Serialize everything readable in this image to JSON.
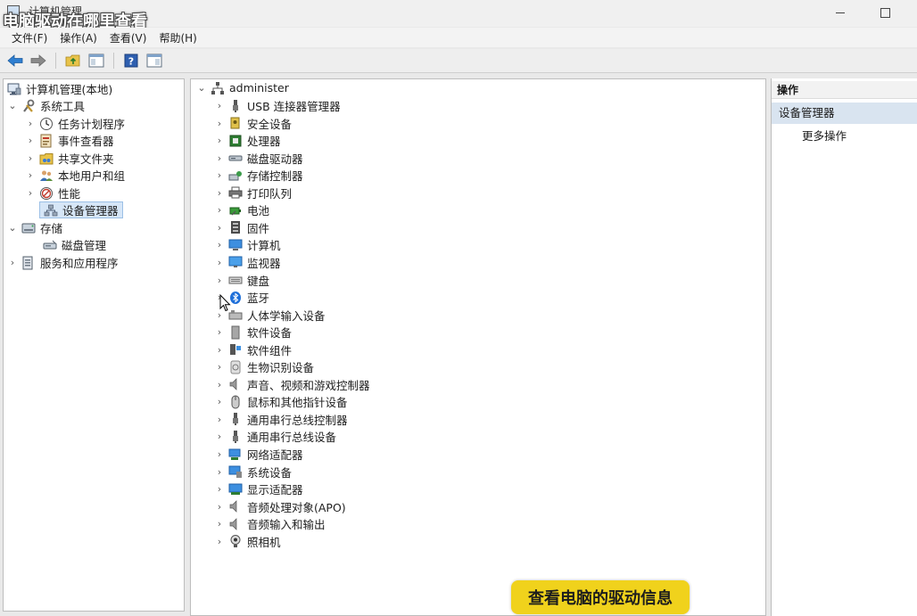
{
  "window": {
    "title": "计算机管理",
    "overlay_title": "电脑驱动在哪里查看"
  },
  "menu": [
    "文件(F)",
    "操作(A)",
    "查看(V)",
    "帮助(H)"
  ],
  "toolbar": {
    "icons": [
      "back-arrow-icon",
      "forward-arrow-icon",
      "up-folder-icon",
      "show-hide-tree-icon",
      "help-icon",
      "show-hide-action-pane-icon"
    ]
  },
  "left_tree": {
    "root": "计算机管理(本地)",
    "items": [
      {
        "label": "系统工具",
        "icon": "tools-icon"
      },
      {
        "label": "任务计划程序",
        "icon": "clock-icon"
      },
      {
        "label": "事件查看器",
        "icon": "event-viewer-icon"
      },
      {
        "label": "共享文件夹",
        "icon": "shared-folder-icon"
      },
      {
        "label": "本地用户和组",
        "icon": "users-icon"
      },
      {
        "label": "性能",
        "icon": "performance-icon"
      },
      {
        "label": "设备管理器",
        "icon": "device-manager-icon"
      },
      {
        "label": "存储",
        "icon": "storage-icon"
      },
      {
        "label": "磁盘管理",
        "icon": "disk-icon"
      },
      {
        "label": "服务和应用程序",
        "icon": "services-icon"
      }
    ]
  },
  "device_tree": {
    "root": "administer",
    "categories": [
      {
        "label": "USB 连接器管理器",
        "icon": "usb-icon"
      },
      {
        "label": "安全设备",
        "icon": "security-key-icon"
      },
      {
        "label": "处理器",
        "icon": "processor-icon"
      },
      {
        "label": "磁盘驱动器",
        "icon": "disk-drive-icon"
      },
      {
        "label": "存储控制器",
        "icon": "storage-controller-icon"
      },
      {
        "label": "打印队列",
        "icon": "printer-icon"
      },
      {
        "label": "电池",
        "icon": "battery-icon"
      },
      {
        "label": "固件",
        "icon": "firmware-icon"
      },
      {
        "label": "计算机",
        "icon": "computer-icon"
      },
      {
        "label": "监视器",
        "icon": "monitor-icon"
      },
      {
        "label": "键盘",
        "icon": "keyboard-icon"
      },
      {
        "label": "蓝牙",
        "icon": "bluetooth-icon"
      },
      {
        "label": "人体学输入设备",
        "icon": "hid-icon"
      },
      {
        "label": "软件设备",
        "icon": "software-device-icon"
      },
      {
        "label": "软件组件",
        "icon": "software-component-icon"
      },
      {
        "label": "生物识别设备",
        "icon": "biometric-icon"
      },
      {
        "label": "声音、视频和游戏控制器",
        "icon": "speaker-icon"
      },
      {
        "label": "鼠标和其他指针设备",
        "icon": "mouse-icon"
      },
      {
        "label": "通用串行总线控制器",
        "icon": "usb-controller-icon"
      },
      {
        "label": "通用串行总线设备",
        "icon": "usb-device-icon"
      },
      {
        "label": "网络适配器",
        "icon": "network-adapter-icon"
      },
      {
        "label": "系统设备",
        "icon": "system-device-icon"
      },
      {
        "label": "显示适配器",
        "icon": "display-adapter-icon"
      },
      {
        "label": "音频处理对象(APO)",
        "icon": "audio-processing-icon"
      },
      {
        "label": "音频输入和输出",
        "icon": "audio-io-icon"
      },
      {
        "label": "照相机",
        "icon": "camera-icon"
      }
    ]
  },
  "actions": {
    "header": "操作",
    "section": "设备管理器",
    "more": "更多操作"
  },
  "caption": "查看电脑的驱动信息"
}
